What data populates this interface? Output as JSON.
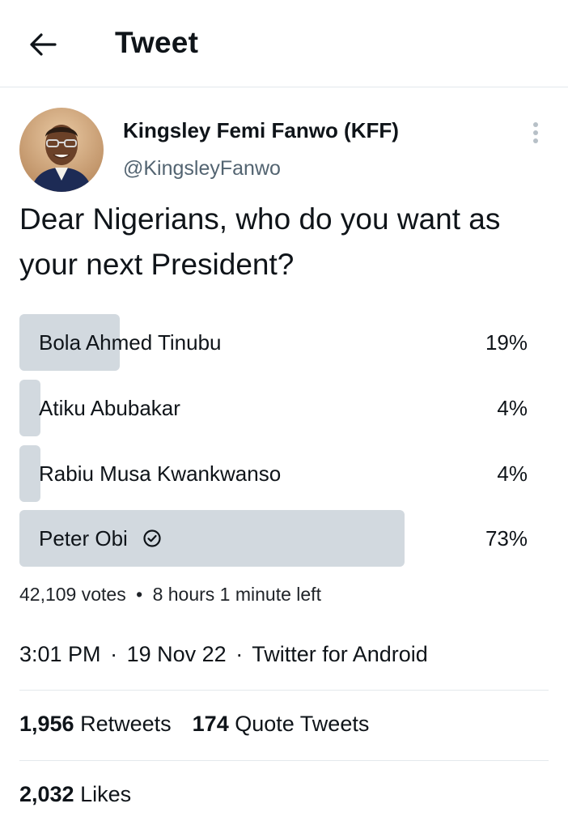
{
  "header": {
    "title": "Tweet"
  },
  "author": {
    "name": "Kingsley Femi Fanwo (KFF)",
    "handle": "@KingsleyFanwo"
  },
  "tweet": {
    "text": "Dear Nigerians, who do you want as your next President?"
  },
  "poll": {
    "options": [
      {
        "label": "Bola Ahmed Tinubu",
        "percent_text": "19%",
        "percent": 19
      },
      {
        "label": "Atiku Abubakar",
        "percent_text": "4%",
        "percent": 4
      },
      {
        "label": "Rabiu Musa Kwankwanso",
        "percent_text": "4%",
        "percent": 4
      },
      {
        "label": "Peter Obi",
        "percent_text": "73%",
        "percent": 73,
        "selected": true
      }
    ],
    "votes": "42,109 votes",
    "separator": "•",
    "time_left": "8 hours 1 minute left"
  },
  "meta": {
    "time": "3:01 PM",
    "date": "19 Nov 22",
    "source": "Twitter for Android",
    "dot": "·"
  },
  "stats": {
    "retweets_count": "1,956",
    "retweets_label": "Retweets",
    "quotes_count": "174",
    "quotes_label": "Quote Tweets",
    "likes_count": "2,032",
    "likes_label": "Likes"
  },
  "colors": {
    "poll_bar": "#d2d9df",
    "secondary_text": "#536471",
    "divider": "#e3e8ec"
  }
}
